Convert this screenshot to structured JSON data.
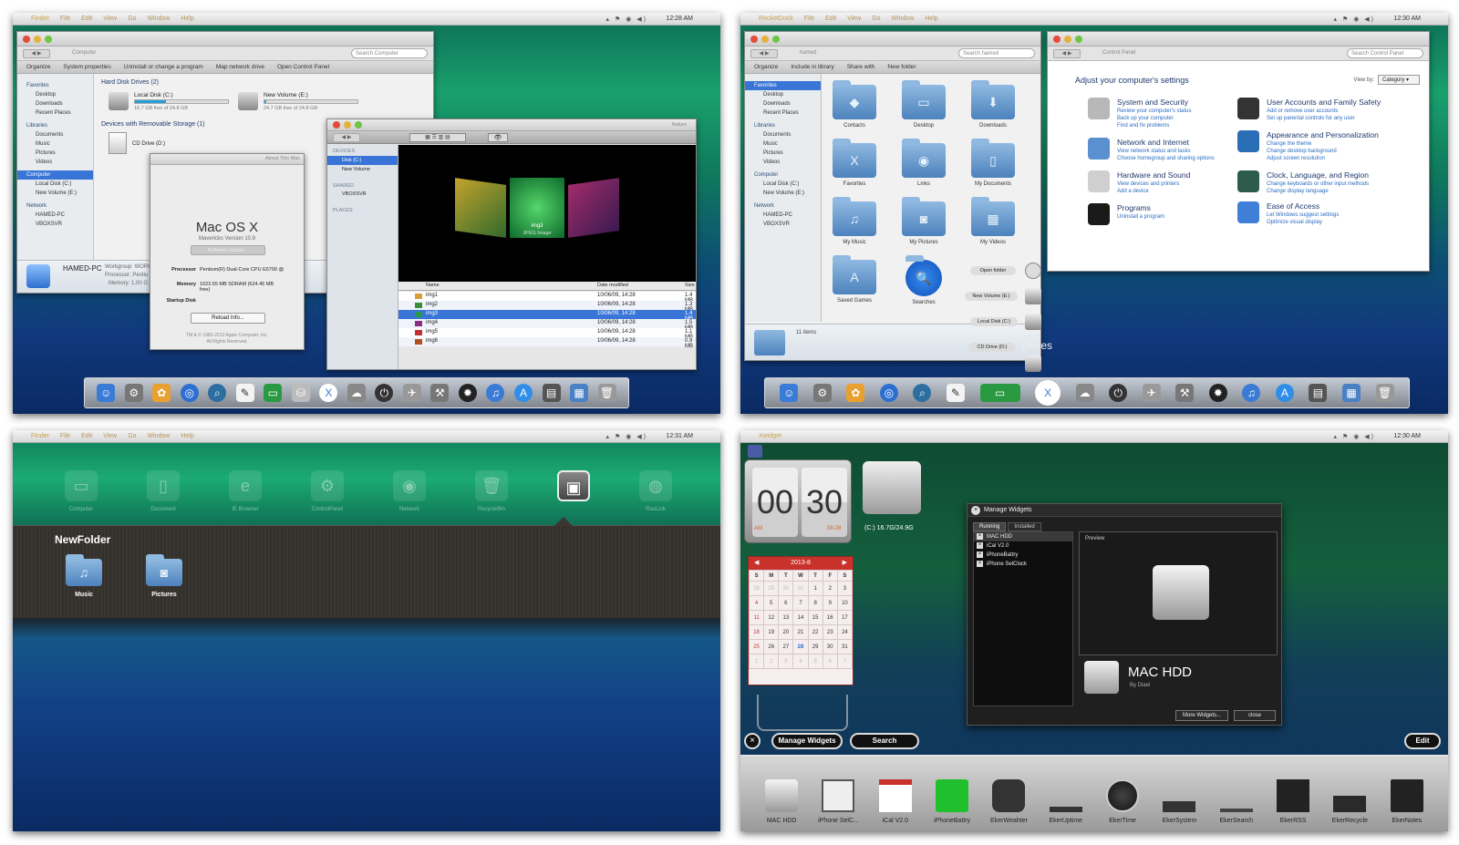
{
  "p1": {
    "menubar": {
      "app": "Finder",
      "items": [
        "File",
        "Edit",
        "View",
        "Go",
        "Window",
        "Help"
      ],
      "time": "12:28 AM"
    },
    "explorer": {
      "path": "Computer",
      "search_placeholder": "Search Computer",
      "toolbar": [
        "Organize",
        "System properties",
        "Uninstall or change a program",
        "Map network drive",
        "Open Control Panel"
      ],
      "sidebar": {
        "favorites": "Favorites",
        "fav_items": [
          "Desktop",
          "Downloads",
          "Recent Places"
        ],
        "libraries": "Libraries",
        "lib_items": [
          "Documents",
          "Music",
          "Pictures",
          "Videos"
        ],
        "computer": "Computer",
        "comp_items": [
          "Local Disk (C:)",
          "New Volume (E:)"
        ],
        "network": "Network",
        "net_items": [
          "HAMED-PC",
          "VBOXSVR"
        ]
      },
      "hdd_group": "Hard Disk Drives (2)",
      "drives": [
        {
          "name": "Local Disk (C:)",
          "free": "16.7 GB free of 24.8 GB",
          "fill": 0.33
        },
        {
          "name": "New Volume (E:)",
          "free": "24.7 GB free of 24.8 GB",
          "fill": 0.02
        }
      ],
      "removable_group": "Devices with Removable Storage (1)",
      "cd": "CD Drive (D:)",
      "footer": {
        "pc": "HAMED-PC",
        "wg_label": "Workgroup:",
        "wg": "WORK",
        "proc_label": "Processor:",
        "proc": "Pentiu",
        "mem_label": "Memory:",
        "mem": "1.00 G"
      }
    },
    "about": {
      "title": "About This Mac",
      "os": "Mac OS X",
      "version": "Mavericks Version 10.9",
      "update_btn": "Software Update...",
      "proc_label": "Processor",
      "proc": "Pentium(R) Dual-Core CPU E5700 @",
      "mem_label": "Memory",
      "mem": "1023.55 MB SDRAM (624.45 MB free)",
      "disk_label": "Startup Disk",
      "reload": "Reload Info...",
      "copy1": "TM & © 1983-2013 Apple Computer, Inc.",
      "copy2": "All Rights Reserved."
    },
    "finder": {
      "title": "Nature",
      "devices": "DEVICES",
      "dev_items": [
        "Disk (C:)",
        "New Volume"
      ],
      "shared": "SHARED",
      "shared_items": [
        "VBOXSVR"
      ],
      "places": "PLACES",
      "preview_name": "img3",
      "preview_type": "JPEG Image",
      "cols": [
        "Name",
        "Date modified",
        "Size"
      ],
      "rows": [
        {
          "name": "img1",
          "date": "10/06/09, 14:28",
          "size": "1.4 MB",
          "color": "#d8a03c"
        },
        {
          "name": "img2",
          "date": "10/06/09, 14:28",
          "size": "1.3 MB",
          "color": "#3c8f3a"
        },
        {
          "name": "img3",
          "date": "10/06/09, 14:28",
          "size": "1.4 MB",
          "color": "#2c9a4c"
        },
        {
          "name": "img4",
          "date": "10/06/09, 14:28",
          "size": "1.5 MB",
          "color": "#8a2f7d"
        },
        {
          "name": "img5",
          "date": "10/06/09, 14:28",
          "size": "1.1 MB",
          "color": "#c03030"
        },
        {
          "name": "img6",
          "date": "10/06/09, 14:28",
          "size": "0.9 MB",
          "color": "#b05020"
        }
      ]
    }
  },
  "p2": {
    "menubar": {
      "app": "RocketDock",
      "items": [
        "File",
        "Edit",
        "View",
        "Go",
        "Window",
        "Help"
      ],
      "time": "12:30 AM"
    },
    "explorer": {
      "path": "hamed",
      "search_placeholder": "Search hamed",
      "toolbar": [
        "Organize",
        "Include in library",
        "Share with",
        "New folder"
      ],
      "sidebar": [
        "Favorites",
        "Desktop",
        "Downloads",
        "Recent Places",
        "Libraries",
        "Documents",
        "Music",
        "Pictures",
        "Videos",
        "Computer",
        "Local Disk (C:)",
        "New Volume (E:)",
        "Network",
        "HAMED-PC",
        "VBOXSVR"
      ],
      "folders": [
        {
          "label": "Contacts",
          "glyph": "◆"
        },
        {
          "label": "Desktop",
          "glyph": "▭"
        },
        {
          "label": "Downloads",
          "glyph": "⬇"
        },
        {
          "label": "Favorites",
          "glyph": "X"
        },
        {
          "label": "Links",
          "glyph": "◉"
        },
        {
          "label": "My Documents",
          "glyph": "▯"
        },
        {
          "label": "My Music",
          "glyph": "♫"
        },
        {
          "label": "My Pictures",
          "glyph": "◙"
        },
        {
          "label": "My Videos",
          "glyph": "▦"
        },
        {
          "label": "Saved Games",
          "glyph": "A"
        },
        {
          "label": "Searches",
          "glyph": "🔍"
        }
      ],
      "count": "11 items"
    },
    "stack": {
      "title": "Drives",
      "items": [
        "Open folder",
        "New Volume (E:)",
        "Local Disk (C:)",
        "CD Drive (D:)"
      ]
    },
    "control": {
      "path": "Control Panel",
      "search_placeholder": "Search Control Panel",
      "heading": "Adjust your computer's settings",
      "viewby_label": "View by:",
      "viewby": "Category",
      "items": [
        {
          "h": "System and Security",
          "l": [
            "Review your computer's status",
            "Back up your computer",
            "Find and fix problems"
          ],
          "color": "#b8b8b8"
        },
        {
          "h": "User Accounts and Family Safety",
          "l": [
            "Add or remove user accounts",
            "Set up parental controls for any user"
          ],
          "color": "#333"
        },
        {
          "h": "Network and Internet",
          "l": [
            "View network status and tasks",
            "Choose homegroup and sharing options"
          ],
          "color": "#5a8fd0"
        },
        {
          "h": "Appearance and Personalization",
          "l": [
            "Change the theme",
            "Change desktop background",
            "Adjust screen resolution"
          ],
          "color": "#2a6fb6"
        },
        {
          "h": "Hardware and Sound",
          "l": [
            "View devices and printers",
            "Add a device"
          ],
          "color": "#cfcfcf"
        },
        {
          "h": "Clock, Language, and Region",
          "l": [
            "Change keyboards or other input methods",
            "Change display language"
          ],
          "color": "#2d5c4e"
        },
        {
          "h": "Programs",
          "l": [
            "Uninstall a program"
          ],
          "color": "#1a1a1a"
        },
        {
          "h": "Ease of Access",
          "l": [
            "Let Windows suggest settings",
            "Optimize visual display"
          ],
          "color": "#3f7fd8"
        }
      ]
    }
  },
  "p3": {
    "menubar": {
      "app": "Finder",
      "items": [
        "File",
        "Edit",
        "View",
        "Go",
        "Window",
        "Help"
      ],
      "time": "12:31 AM"
    },
    "launch": [
      {
        "label": "Computer",
        "glyph": "▭"
      },
      {
        "label": "Document",
        "glyph": "▯"
      },
      {
        "label": "IE Browser",
        "glyph": "e"
      },
      {
        "label": "ControlPanel",
        "glyph": "⚙"
      },
      {
        "label": "Network",
        "glyph": "◉"
      },
      {
        "label": "RecycleBin",
        "glyph": "🗑"
      },
      {
        "label": "",
        "glyph": "▣"
      },
      {
        "label": "RasLink",
        "glyph": "◍"
      }
    ],
    "folder_title": "NewFolder",
    "folder_items": [
      {
        "label": "Music",
        "glyph": "♫"
      },
      {
        "label": "Pictures",
        "glyph": "◙"
      }
    ]
  },
  "p4": {
    "menubar": {
      "app": "Xwidget",
      "time": "12:30 AM"
    },
    "clock": {
      "h": "00",
      "m": "30",
      "ampm": "AM",
      "date": "08-28"
    },
    "hdd_widget": {
      "label": "(C:) 16.7G/24.9G"
    },
    "calendar": {
      "month": "2013-8",
      "weekdays": [
        "S",
        "M",
        "T",
        "W",
        "T",
        "F",
        "S"
      ],
      "days": [
        [
          "28",
          "29",
          "30",
          "31",
          "1",
          "2",
          "3"
        ],
        [
          "4",
          "5",
          "6",
          "7",
          "8",
          "9",
          "10"
        ],
        [
          "11",
          "12",
          "13",
          "14",
          "15",
          "16",
          "17"
        ],
        [
          "18",
          "19",
          "20",
          "21",
          "22",
          "23",
          "24"
        ],
        [
          "25",
          "26",
          "27",
          "28",
          "29",
          "30",
          "31"
        ],
        [
          "1",
          "2",
          "3",
          "4",
          "5",
          "6",
          "7"
        ]
      ]
    },
    "manager": {
      "title": "Manage Widgets",
      "tabs": [
        "Running",
        "Installed"
      ],
      "list": [
        "MAC HDD",
        "iCal V2.0",
        "iPhoneBattry",
        "iPhone SelClock"
      ],
      "preview_label": "Preview",
      "name": "MAC HDD",
      "author": "By Diael",
      "more": "More Widgets...",
      "close": "close"
    },
    "buttons": {
      "manage": "Manage Widgets",
      "search": "Search",
      "edit": "Edit"
    },
    "dock": [
      {
        "label": "MAC HDD"
      },
      {
        "label": "iPhone SelC..."
      },
      {
        "label": "iCal V2.0"
      },
      {
        "label": "iPhoneBattry"
      },
      {
        "label": "EkerWeahter"
      },
      {
        "label": "EkerUptime"
      },
      {
        "label": "EkerTime"
      },
      {
        "label": "EkerSystem"
      },
      {
        "label": "EkerSearch"
      },
      {
        "label": "EkerRSS"
      },
      {
        "label": "EkerRecycle"
      },
      {
        "label": "EkerNotes"
      }
    ]
  },
  "colors": {
    "selection": "#3875d7",
    "accent_green": "#1aa06e",
    "deep_blue": "#11397c",
    "cal_red": "#c8322a",
    "folder_blue": "#4d82bd"
  }
}
